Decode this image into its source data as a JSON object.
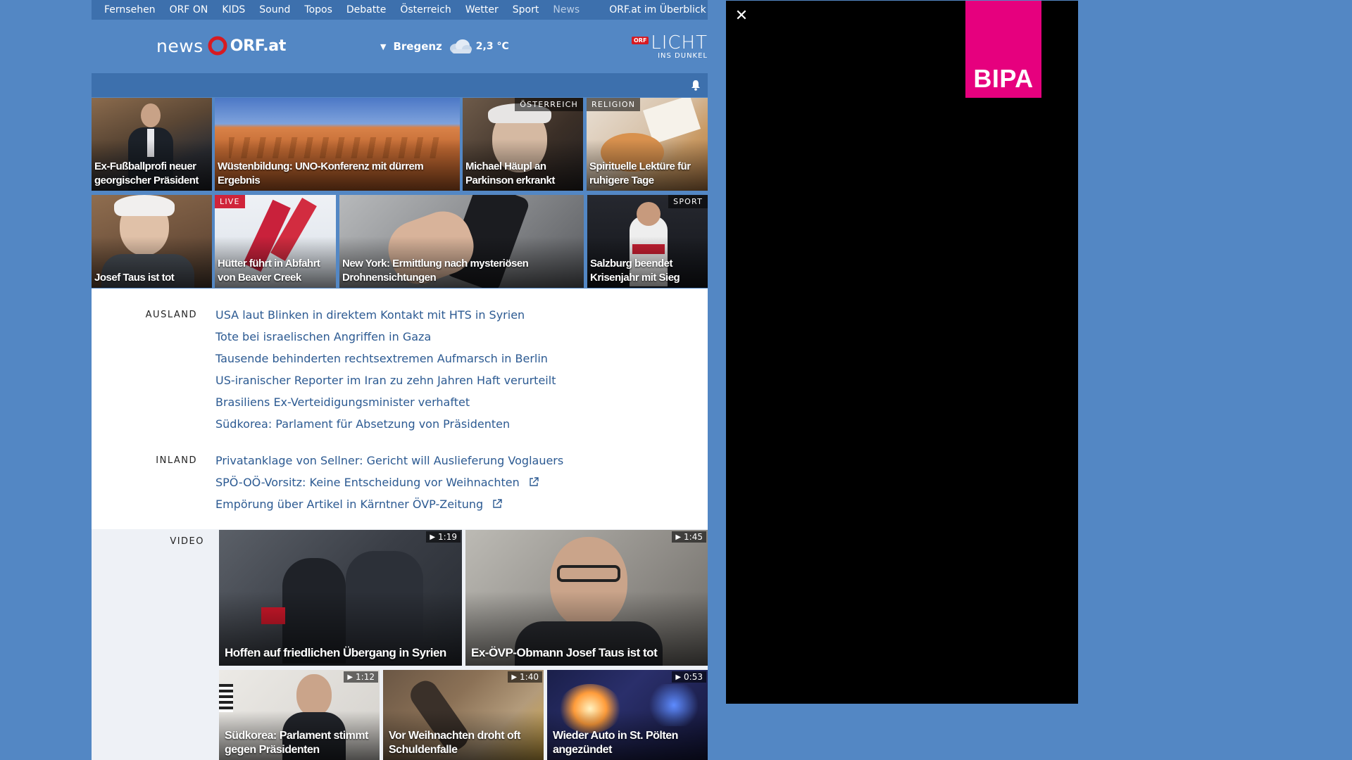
{
  "topnav": {
    "items": [
      "Fernsehen",
      "ORF ON",
      "KIDS",
      "Sound",
      "Topos",
      "Debatte",
      "Österreich",
      "Wetter",
      "Sport",
      "News"
    ],
    "active": "News",
    "overview": "ORF.at im Überblick"
  },
  "header": {
    "logo_news": "news",
    "logo_orfat": "ORF.at",
    "weather": {
      "city": "Bregenz",
      "temp": "2,3 °C"
    },
    "licht": {
      "orf": "ORF",
      "word": "LICHT",
      "sub": "INS DUNKEL"
    }
  },
  "tiles": [
    {
      "caption": "Ex-Fußballprofi neuer georgischer Präsident",
      "badge": ""
    },
    {
      "caption": "Wüstenbildung: UNO-Konferenz mit dürrem Ergebnis",
      "badge": ""
    },
    {
      "caption": "Michael Häupl an Parkinson erkrankt",
      "badge": "ÖSTERREICH"
    },
    {
      "caption": "Spirituelle Lektüre für ruhigere Tage",
      "badge": "RELIGION"
    },
    {
      "caption": "Josef Taus ist tot",
      "badge": ""
    },
    {
      "caption": "Hütter führt in Abfahrt von Beaver Creek",
      "badge": "LIVE"
    },
    {
      "caption": "New York: Ermittlung nach mysteriösen Drohnensichtungen",
      "badge": ""
    },
    {
      "caption": "Salzburg beendet Krisenjahr mit Sieg",
      "badge": "SPORT"
    }
  ],
  "sections": {
    "ausland": {
      "label": "AUSLAND",
      "headlines": [
        "USA laut Blinken in direktem Kontakt mit HTS in Syrien",
        "Tote bei israelischen Angriffen in Gaza",
        "Tausende behinderten rechtsextremen Aufmarsch in Berlin",
        "US-iranischer Reporter im Iran zu zehn Jahren Haft verurteilt",
        "Brasiliens Ex-Verteidigungsminister verhaftet",
        "Südkorea: Parlament für Absetzung von Präsidenten"
      ]
    },
    "inland": {
      "label": "INLAND",
      "headlines": [
        "Privatanklage von Sellner: Gericht will Auslieferung Voglauers",
        "SPÖ-OÖ-Vorsitz: Keine Entscheidung vor Weihnachten",
        "Empörung über Artikel in Kärntner ÖVP-Zeitung"
      ]
    },
    "video": {
      "label": "VIDEO",
      "items": [
        {
          "caption": "Hoffen auf friedlichen Übergang in Syrien",
          "duration": "1:19"
        },
        {
          "caption": "Ex-ÖVP-Obmann Josef Taus ist tot",
          "duration": "1:45"
        },
        {
          "caption": "Südkorea: Parlament stimmt gegen Präsidenten",
          "duration": "1:12"
        },
        {
          "caption": "Vor Weihnachten droht oft Schuldenfalle",
          "duration": "1:40"
        },
        {
          "caption": "Wieder Auto in St. Pölten angezündet",
          "duration": "0:53"
        }
      ]
    }
  },
  "ad": {
    "close": "✕",
    "brand": "BIPA",
    "brand_color": "#e6007e"
  },
  "colors": {
    "page_bg": "#5387c4",
    "nav_bg": "#3d70ad",
    "link": "#2c5a92",
    "live": "#d0243a"
  }
}
